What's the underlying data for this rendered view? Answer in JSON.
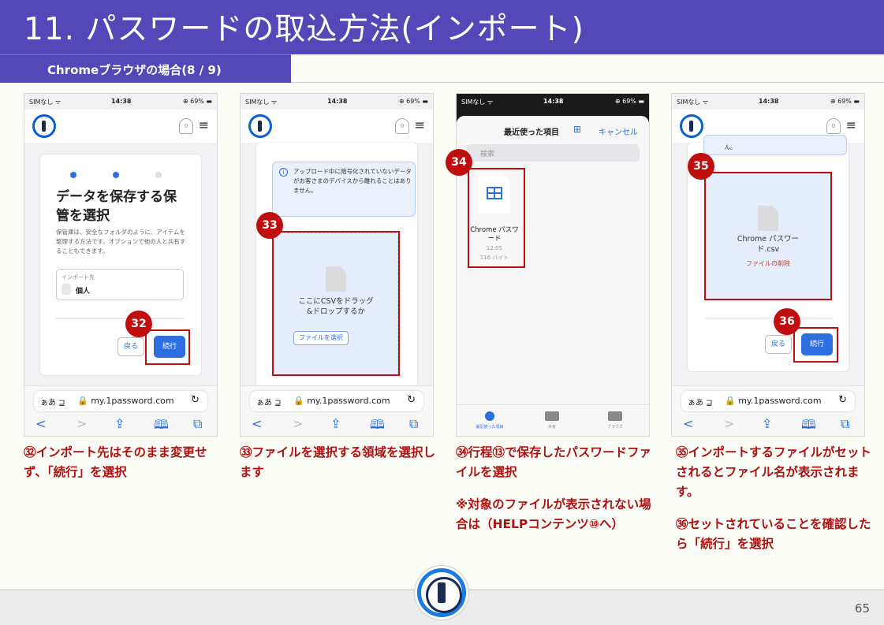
{
  "title": "11. パスワードの取込方法(インポート)",
  "subtitle": "Chromeブラウザの場合(8 / 9)",
  "status": {
    "carrier": "SIMなし ᯤ",
    "time": "14:38",
    "battery": "⊕ 69% ▬"
  },
  "browser": {
    "aa": "ぁあ ⊒",
    "url": "🔒 my.1password.com",
    "reload": "↻",
    "nav": [
      "<",
      ">",
      "⇪",
      "🕮",
      "⧉"
    ]
  },
  "phone1": {
    "heading": "データを保存する保管を選択",
    "desc": "保管庫は、安全なフォルダのように、アイテムを整理する方法です。オプションで他の人と共有することもできます。",
    "import_to_label": "インポート先",
    "vault": "個人",
    "back": "戻る",
    "next": "続行",
    "badge": "32"
  },
  "phone2": {
    "info": "アップロード中に暗号化されていないデータがお客さまのデバイスから離れることはありません。",
    "drop_text": "ここにCSVをドラッグ&ドロップするか",
    "choose_file": "ファイルを選択",
    "badge": "33"
  },
  "phone3": {
    "header_title": "最近使った項目",
    "cancel": "キャンセル",
    "search_placeholder": "検索",
    "file_name": "Chrome パスワード",
    "file_time": "12:05",
    "file_size": "116 バイト",
    "tabs": [
      "最近使った項目",
      "共有",
      "ブラウズ"
    ],
    "badge": "34"
  },
  "phone4": {
    "file_name": "Chrome パスワード.csv",
    "remove": "ファイルの削除",
    "back": "戻る",
    "next": "続行",
    "badge1": "35",
    "badge2": "36",
    "trunc_text": "ん。"
  },
  "captions": {
    "c1": "㉜インポート先はそのまま変更せず、「続行」を選択",
    "c2": "㉝ファイルを選択する領域を選択します",
    "c3a": "㉞行程⑬で保存したパスワードファイルを選択",
    "c3b": "※対象のファイルが表示されない場合は（HELPコンテンツ⑩へ）",
    "c4a": "㉟インポートするファイルがセットされるとファイル名が表示されます。",
    "c4b": "㊱セットされていることを確認したら「続行」を選択"
  },
  "page_number": "65",
  "colors": {
    "header": "#5447b8",
    "accent": "#c00d0d",
    "primary_button": "#2d6fe0"
  }
}
